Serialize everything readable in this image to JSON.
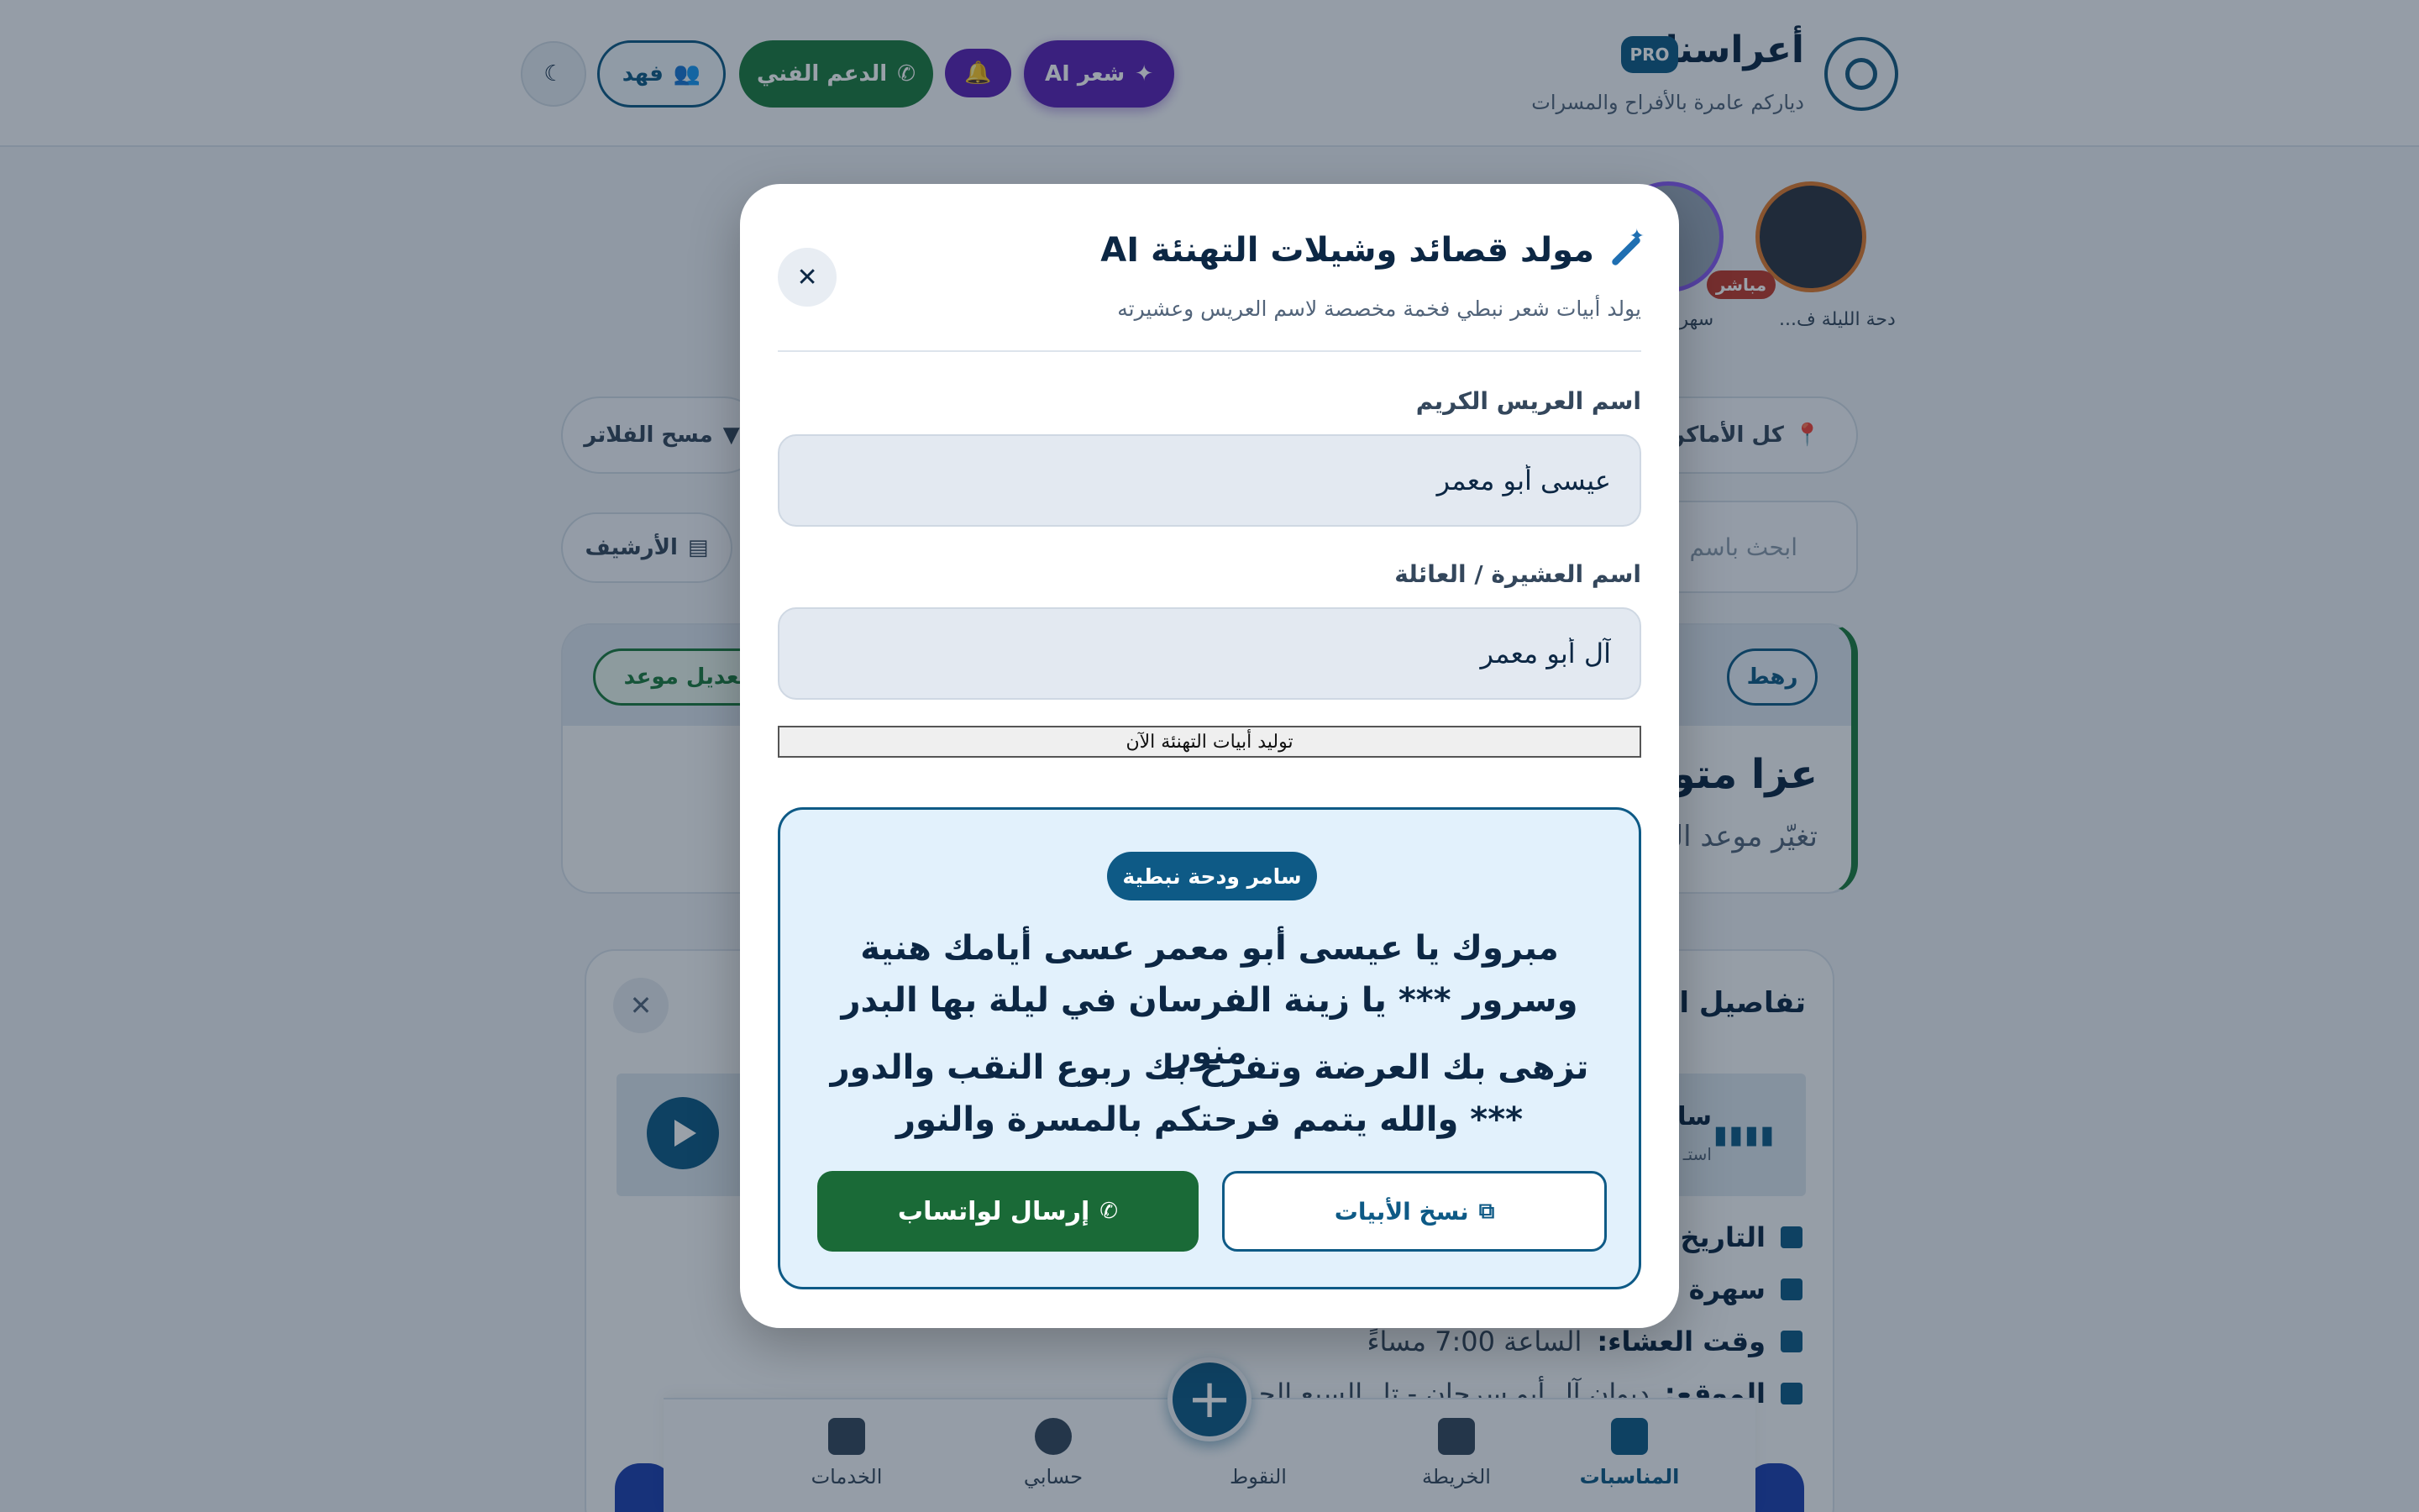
{
  "header": {
    "brand_name": "أعراسنا",
    "pro_badge": "PRO",
    "tagline": "دياركم عامرة بالأفراح والمسرات",
    "ai_poetry_button": "شعر AI",
    "support_button": "الدعم الفني",
    "user_button": "فهد"
  },
  "stories": {
    "live_badge": "مباشر",
    "items": [
      {
        "label": "دحة الليلة ف..."
      },
      {
        "label": "سهرة"
      }
    ]
  },
  "filters": {
    "all_places": "كل الأماكن",
    "clear_filters": "مسح الفلاتر",
    "search_placeholder": "ابحث باسم",
    "archive": "الأرشيف"
  },
  "event_card": {
    "badge": "رهط",
    "edit_date_button": "تعديل موعد",
    "title": "عزا متوفّ",
    "subtitle": "تغيّر موعد الد"
  },
  "details_card": {
    "title": "تفاصيل الد",
    "player_title": "سا",
    "player_sub": "استـ",
    "date_label": "التاريخ:",
    "evening_label": "سهرة ا",
    "dinner_label": "وقت العشاء:",
    "dinner_value": "الساعة 7:00 مساءً",
    "location_label": "الموقع:",
    "location_value": "ديوان آل أبو سرحان - تل السبع الحـ... الغير"
  },
  "bottom_nav": {
    "items": [
      {
        "label": "المناسبات",
        "active": true
      },
      {
        "label": "الخريطة",
        "active": false
      },
      {
        "label": "النقوط",
        "active": false
      },
      {
        "label": "حسابي",
        "active": false
      },
      {
        "label": "الخدمات",
        "active": false
      }
    ],
    "fab_symbol": "+"
  },
  "modal": {
    "title": "مولد قصائد وشيلات التهنئة AI",
    "subtitle": "يولد أبيات شعر نبطي فخمة مخصصة لاسم العريس وعشيرته",
    "close_symbol": "✕",
    "groom_label": "اسم العريس الكريم",
    "groom_value": "عيسى أبو معمر",
    "clan_label": "اسم العشيرة / العائلة",
    "clan_value": "آل أبو معمر",
    "generate_button": "توليد أبيات التهنئة الآن",
    "result": {
      "badge": "سامر ودحة نبطية",
      "verse_1": "مبروك يا عيسى أبو معمر عسى أيامك هنية وسرور *** يا زينة الفرسان في ليلة بها البدر منور",
      "verse_2": "تزهى بك العرضة وتفرح بك ربوع النقب والدور *** والله يتمم فرحتكم بالمسرة والنور",
      "copy_button": "نسخ الأبيات",
      "whatsapp_button": "إرسال لواتساب"
    }
  },
  "colors": {
    "primary": "#0e5a86",
    "ai_purple": "#5b21b6",
    "whatsapp_green": "#1a6a37",
    "result_bg": "#e2f1fc"
  }
}
